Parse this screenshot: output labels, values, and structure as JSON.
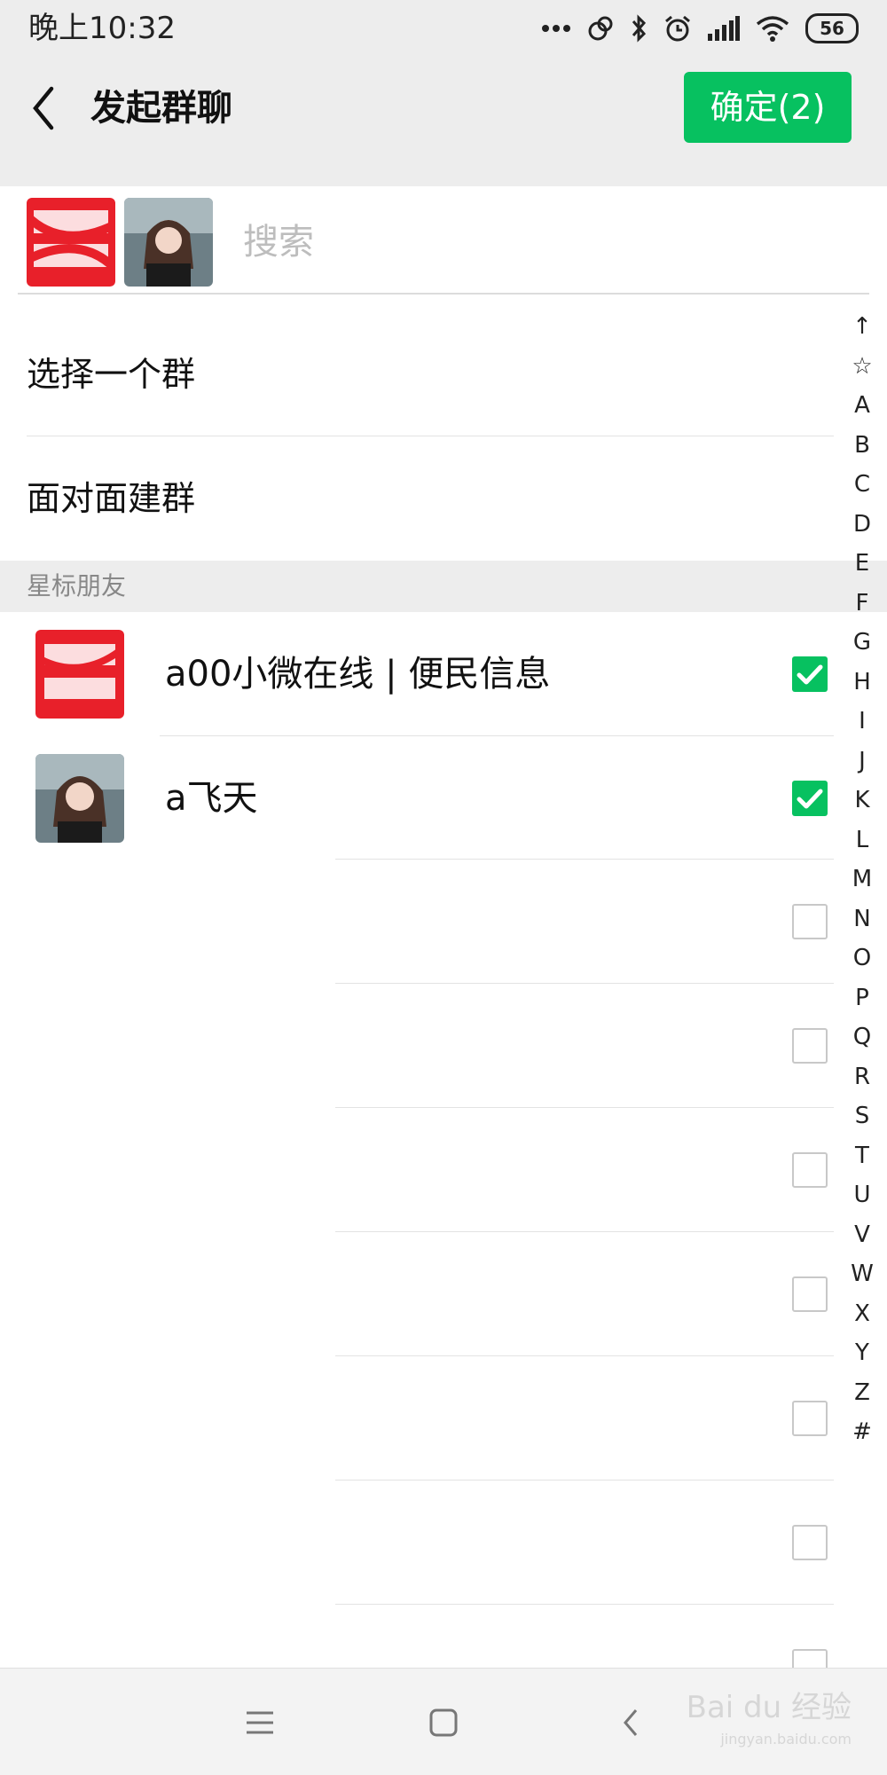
{
  "status_bar": {
    "time": "晚上10:32",
    "battery": "56"
  },
  "header": {
    "title": "发起群聊",
    "confirm_label": "确定(2)"
  },
  "search": {
    "placeholder": "搜索"
  },
  "menu": [
    {
      "label": "选择一个群"
    },
    {
      "label": "面对面建群"
    }
  ],
  "starred_section": {
    "title": "星标朋友",
    "contacts": [
      {
        "name": "a00小微在线 | 便民信息",
        "checked": true
      },
      {
        "name": "a飞天",
        "checked": true
      },
      {
        "name": "",
        "checked": false
      },
      {
        "name": "",
        "checked": false
      },
      {
        "name": "",
        "checked": false
      },
      {
        "name": "",
        "checked": false
      },
      {
        "name": "",
        "checked": false
      },
      {
        "name": "",
        "checked": false
      }
    ]
  },
  "index_bar": [
    "↑",
    "☆",
    "A",
    "B",
    "C",
    "D",
    "E",
    "F",
    "G",
    "H",
    "I",
    "J",
    "K",
    "L",
    "M",
    "N",
    "O",
    "P",
    "Q",
    "R",
    "S",
    "T",
    "U",
    "V",
    "W",
    "X",
    "Y",
    "Z",
    "#"
  ],
  "watermark": {
    "brand": "Bai du 经验",
    "url": "jingyan.baidu.com"
  },
  "colors": {
    "accent": "#07c160",
    "header_bg": "#ededed"
  }
}
